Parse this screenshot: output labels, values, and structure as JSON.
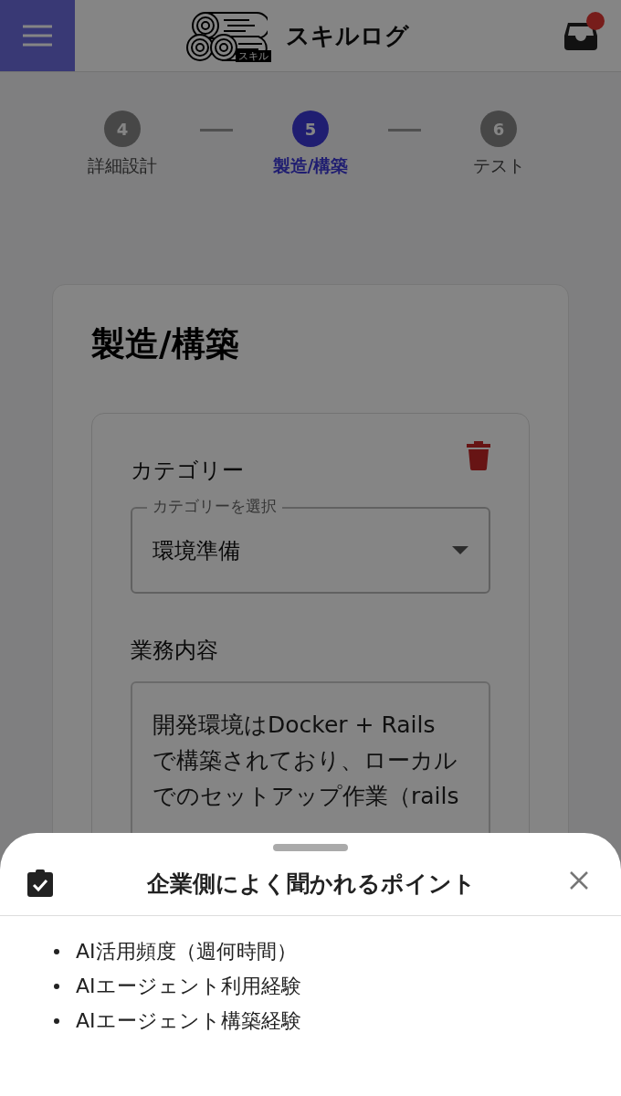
{
  "app_bar": {
    "logo_tag": "スキル",
    "title": "スキルログ",
    "has_notification": true
  },
  "stepper": [
    {
      "number": "4",
      "label": "詳細設計",
      "selected": false
    },
    {
      "number": "5",
      "label": "製造/構築",
      "selected": true
    },
    {
      "number": "6",
      "label": "テスト",
      "selected": false
    }
  ],
  "section": {
    "title": "製造/構築",
    "entry": {
      "category_label": "カテゴリー",
      "select_label": "カテゴリーを選択",
      "select_value": "環境準備",
      "content_label": "業務内容",
      "content_lines": [
        "開発環境はDocker + Rails",
        "で構築されており、ローカル",
        "でのセットアップ作業（rails"
      ]
    }
  },
  "bottom_sheet": {
    "title": "企業側によく聞かれるポイント",
    "items": [
      "AI活用頻度（週何時間）",
      "AIエージェント利用経験",
      "AIエージェント構築経験"
    ]
  }
}
